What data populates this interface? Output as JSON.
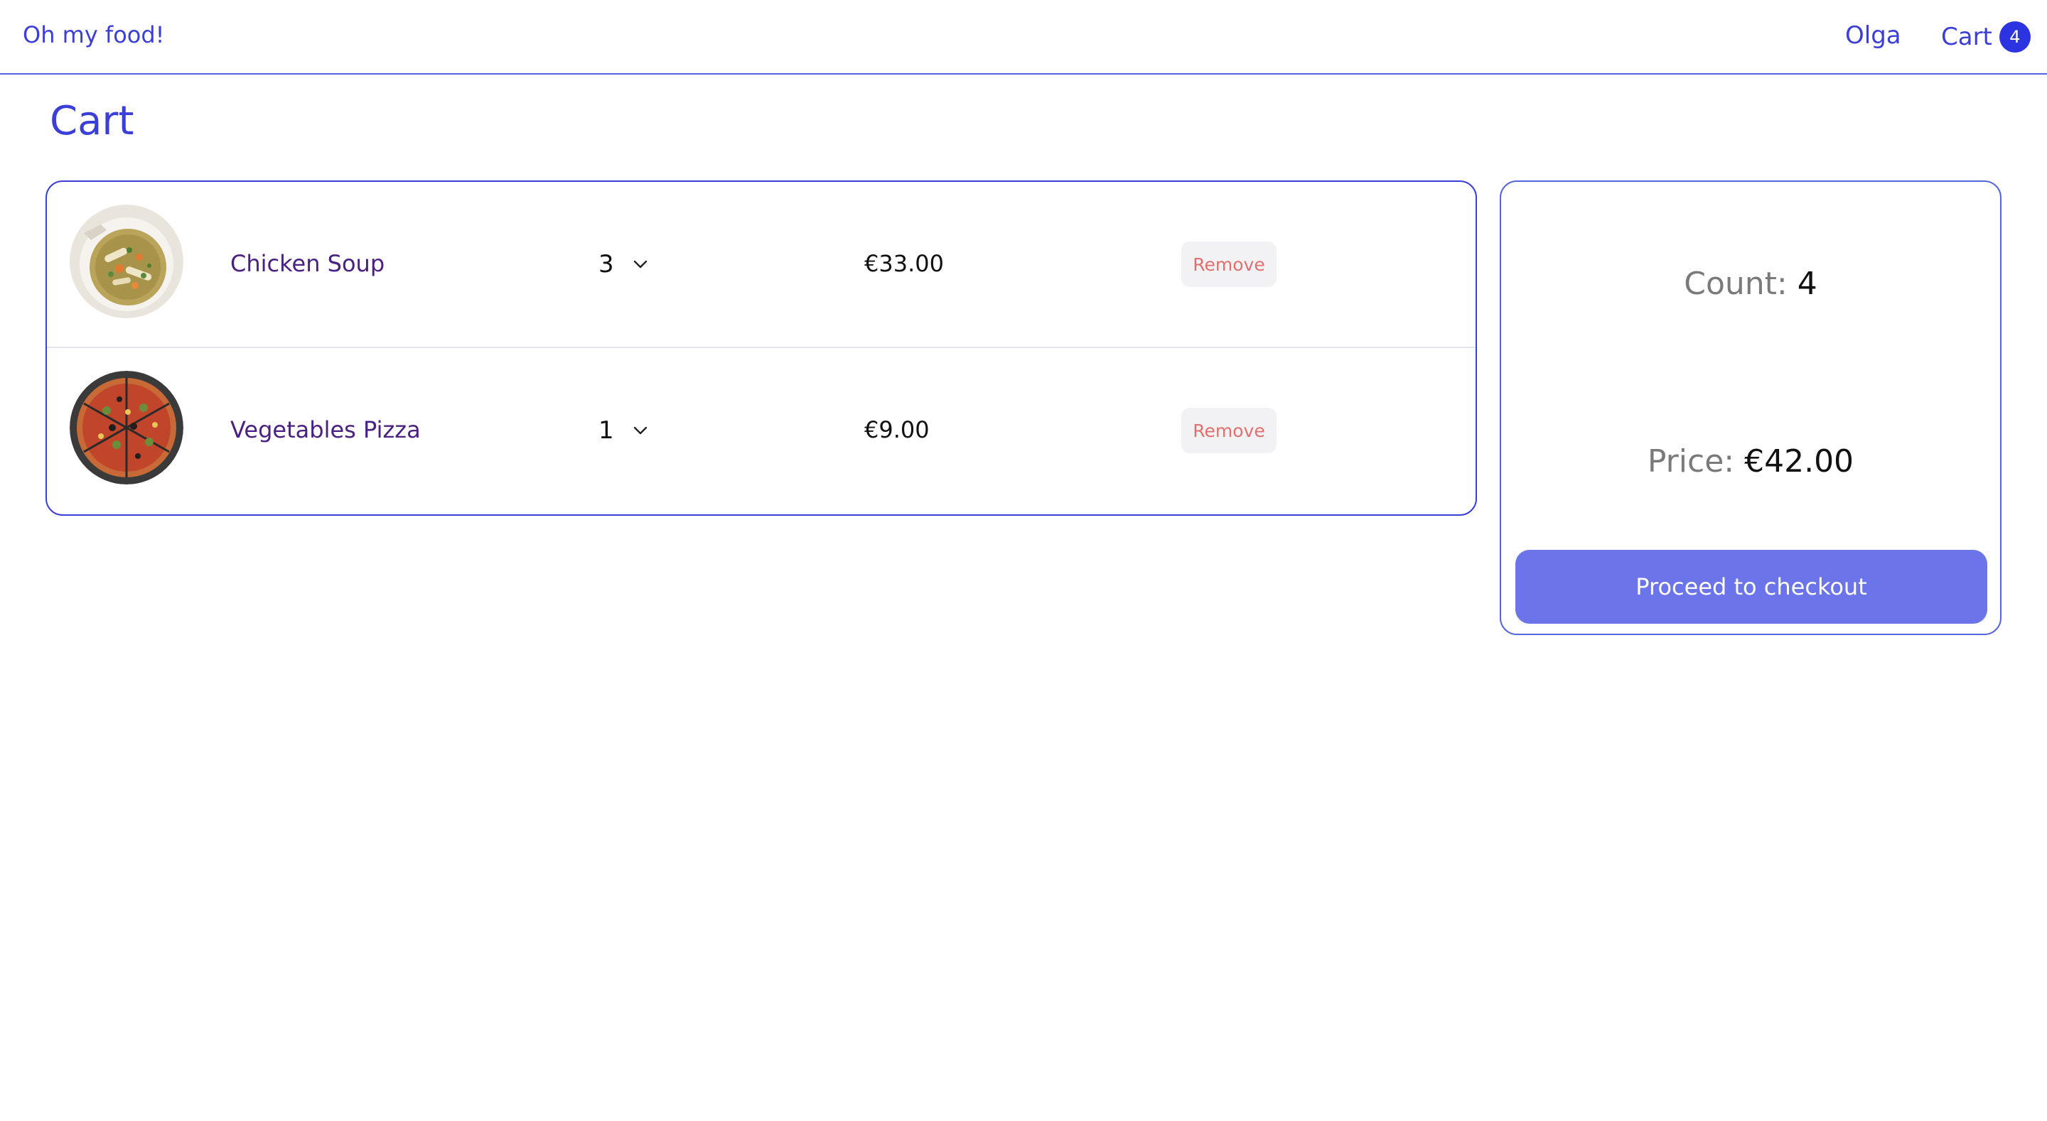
{
  "header": {
    "brand": "Oh my food!",
    "user": "Olga",
    "cart_label": "Cart",
    "cart_count": "4"
  },
  "page": {
    "title": "Cart"
  },
  "items": [
    {
      "name": "Chicken Soup",
      "quantity": "3",
      "price": "€33.00",
      "remove_label": "Remove",
      "image": "chicken-soup-photo"
    },
    {
      "name": "Vegetables Pizza",
      "quantity": "1",
      "price": "€9.00",
      "remove_label": "Remove",
      "image": "vegetables-pizza-photo"
    }
  ],
  "summary": {
    "count_label": "Count:",
    "count_value": "4",
    "price_label": "Price:",
    "price_value": "€42.00",
    "checkout_label": "Proceed to checkout"
  },
  "colors": {
    "accent": "#3b3fd8",
    "badge": "#2b34e0",
    "checkout": "#6b74e8",
    "remove_text": "#e07070",
    "item_name": "#4a2080"
  },
  "icons": {
    "quantity_dropdown": "chevron-down-icon"
  }
}
